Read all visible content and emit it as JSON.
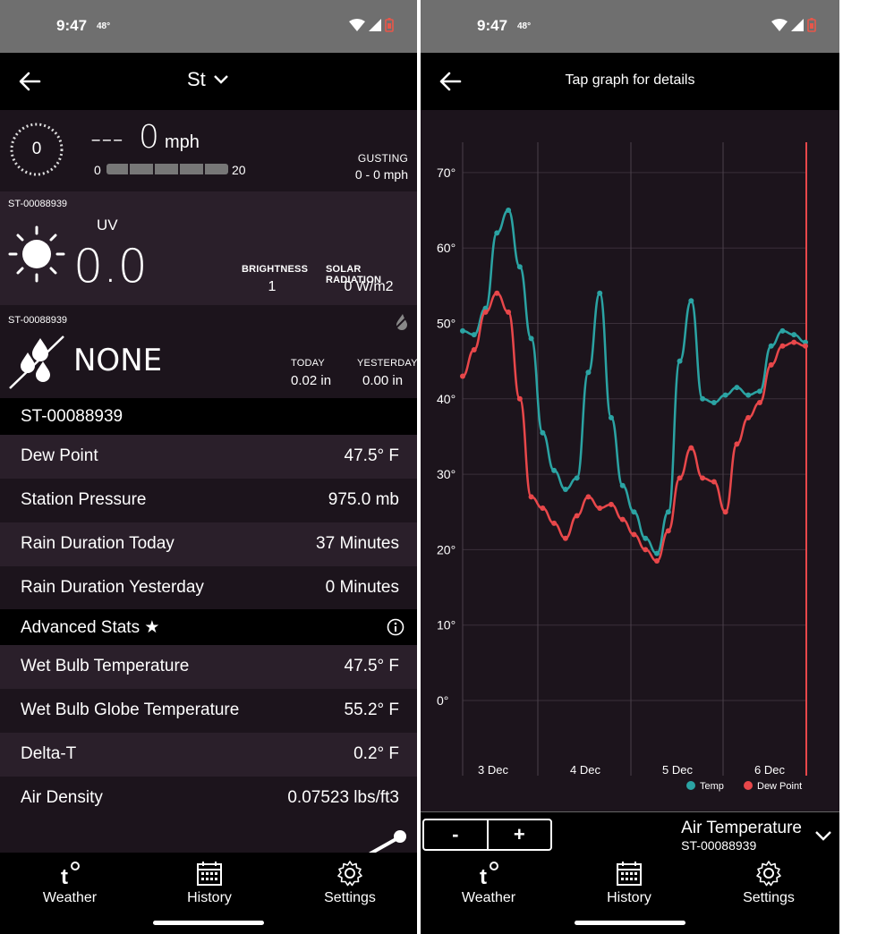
{
  "status_bar": {
    "time": "9:47",
    "temp": "48°"
  },
  "left": {
    "station_selector": "St",
    "wind": {
      "direction_value": "0",
      "speed_prefix": "---",
      "speed": "0",
      "unit": "mph",
      "scale_min": "0",
      "scale_max": "20",
      "gusting_label": "GUSTING",
      "gusting_value": "0 - 0 mph"
    },
    "uv_panel": {
      "device_id": "ST-00088939",
      "uv_label": "UV",
      "uv_value": "0.0",
      "brightness_label": "BRIGHTNESS",
      "brightness_value": "1",
      "solar_label": "SOLAR RADIATION",
      "solar_value": "0 W/m2"
    },
    "rain_panel": {
      "device_id": "ST-00088939",
      "status": "NONE",
      "today_label": "TODAY",
      "today_value": "0.02 in",
      "yesterday_label": "YESTERDAY",
      "yesterday_value": "0.00 in"
    },
    "station_header": "ST-00088939",
    "stats": [
      {
        "label": "Dew Point",
        "value": "47.5° F"
      },
      {
        "label": "Station Pressure",
        "value": "975.0 mb"
      },
      {
        "label": "Rain Duration Today",
        "value": "37 Minutes"
      },
      {
        "label": "Rain Duration Yesterday",
        "value": "0 Minutes"
      }
    ],
    "advanced_header": "Advanced Stats ★",
    "advanced_stats": [
      {
        "label": "Wet Bulb Temperature",
        "value": "47.5° F"
      },
      {
        "label": "Wet Bulb Globe Temperature",
        "value": "55.2° F"
      },
      {
        "label": "Delta-T",
        "value": "0.2° F"
      },
      {
        "label": "Air Density",
        "value": "0.07523 lbs/ft3"
      }
    ]
  },
  "nav": {
    "weather": "Weather",
    "history": "History",
    "settings": "Settings"
  },
  "right": {
    "title": "Tap graph for details",
    "zoom_out": "-",
    "zoom_in": "+",
    "metric": "Air Temperature",
    "metric_station": "ST-00088939"
  },
  "chart_data": {
    "type": "line",
    "y_ticks": [
      "70°",
      "60°",
      "50°",
      "40°",
      "30°",
      "20°",
      "10°",
      "0°"
    ],
    "ylim": [
      -10,
      75
    ],
    "x_labels": [
      "3 Dec",
      "4 Dec",
      "5 Dec",
      "6 Dec"
    ],
    "grid": true,
    "legend_position": "bottom-right",
    "series": [
      {
        "name": "Temp",
        "color": "#2ba3a3",
        "values": [
          49,
          48.5,
          52,
          62,
          65,
          57.5,
          48,
          35.5,
          30.5,
          28,
          29.5,
          43.5,
          54,
          37.5,
          28.5,
          25,
          21.5,
          19.5,
          25,
          45,
          53,
          40,
          39.5,
          40.5,
          41.5,
          40.5,
          41,
          47,
          49,
          48.5,
          47.5
        ]
      },
      {
        "name": "Dew Point",
        "color": "#e8474a",
        "values": [
          43,
          46.5,
          51.5,
          54,
          51.5,
          40,
          27,
          25.5,
          23.5,
          21.5,
          24.5,
          27,
          25.5,
          26,
          24,
          22,
          20,
          18.5,
          22.5,
          29.5,
          33.5,
          29.5,
          29,
          25,
          34,
          37.5,
          39.5,
          44.5,
          47,
          47.5,
          47
        ]
      }
    ]
  }
}
